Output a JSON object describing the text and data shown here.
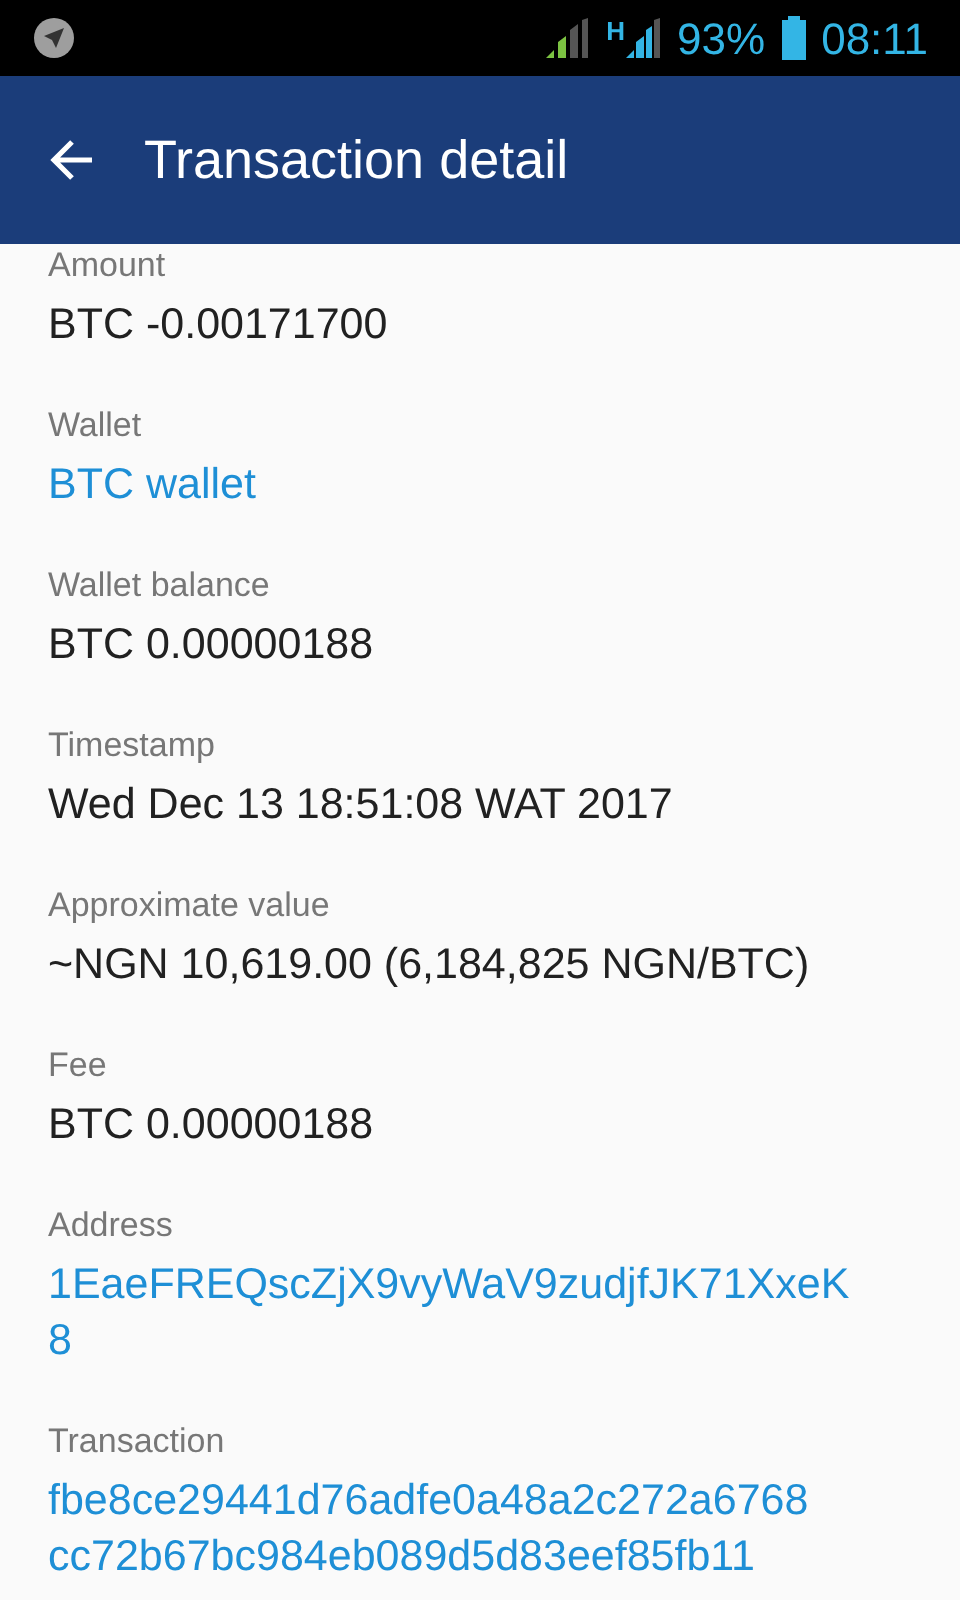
{
  "status_bar": {
    "network_type": "H",
    "battery": "93%",
    "time": "08:11"
  },
  "app_bar": {
    "title": "Transaction detail"
  },
  "fields": [
    {
      "label": "Amount",
      "kind": "text",
      "lines": [
        "BTC -0.00171700"
      ]
    },
    {
      "label": "Wallet",
      "kind": "link",
      "lines": [
        "BTC wallet"
      ]
    },
    {
      "label": "Wallet balance",
      "kind": "text",
      "lines": [
        "BTC 0.00000188"
      ]
    },
    {
      "label": "Timestamp",
      "kind": "text",
      "lines": [
        "Wed Dec 13 18:51:08 WAT 2017"
      ]
    },
    {
      "label": "Approximate value",
      "kind": "text",
      "lines": [
        "~NGN 10,619.00 (6,184,825 NGN/BTC)"
      ]
    },
    {
      "label": "Fee",
      "kind": "text",
      "lines": [
        "BTC 0.00000188"
      ]
    },
    {
      "label": "Address",
      "kind": "link",
      "lines": [
        "1EaeFREQscZjX9vyWaV9zudjfJK71XxeK",
        "8"
      ]
    },
    {
      "label": "Transaction",
      "kind": "link",
      "lines": [
        "fbe8ce29441d76adfe0a48a2c272a6768",
        "cc72b67bc984eb089d5d83eef85fb11"
      ]
    }
  ]
}
